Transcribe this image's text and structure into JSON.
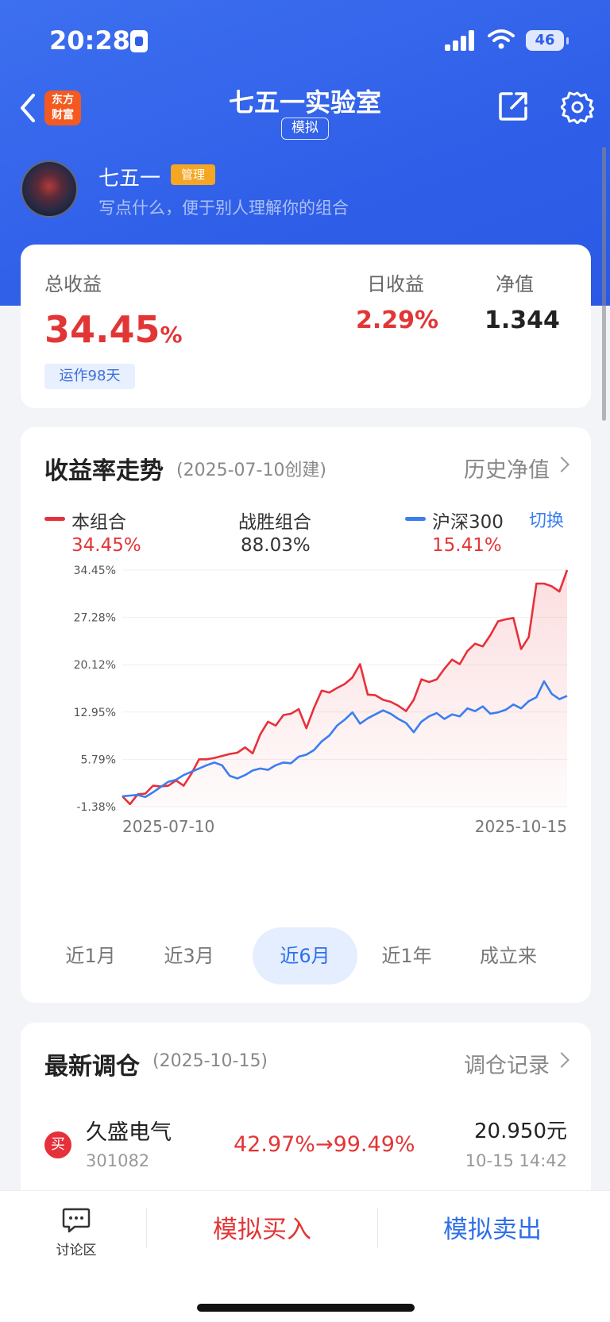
{
  "status_bar": {
    "time": "20:28",
    "battery": "46"
  },
  "header": {
    "title": "七五一实验室",
    "badge": "模拟",
    "brand_line1": "东方",
    "brand_line2": "财富"
  },
  "profile": {
    "name": "七五一",
    "role_badge": "管理",
    "description": "写点什么，便于别人理解你的组合"
  },
  "summary": {
    "total_label": "总收益",
    "total_value": "34.45",
    "total_unit": "%",
    "days": "运作98天",
    "daily_label": "日收益",
    "daily_value": "2.29%",
    "nav_label": "净值",
    "nav_value": "1.344"
  },
  "trend": {
    "title": "收益率走势",
    "created": "(2025-07-10创建)",
    "history_link": "历史净值",
    "switch": "切换",
    "legend": [
      {
        "name": "本组合",
        "value": "34.45%",
        "color": "#e8303a"
      },
      {
        "name": "战胜组合",
        "value": "88.03%",
        "color": "#333333"
      },
      {
        "name": "沪深300",
        "value": "15.41%",
        "color": "#3a7ef0"
      }
    ],
    "tabs": [
      "近1月",
      "近3月",
      "近6月",
      "近1年",
      "成立来"
    ],
    "active_tab": "近6月"
  },
  "chart_data": {
    "type": "line",
    "x_start": "2025-07-10",
    "x_end": "2025-10-15",
    "y_ticks": [
      "34.45%",
      "27.28%",
      "20.12%",
      "12.95%",
      "5.79%",
      "-1.38%"
    ],
    "ylim": [
      -1.38,
      34.45
    ],
    "grid": true,
    "series": [
      {
        "name": "本组合",
        "color": "#e8303a",
        "fill": true,
        "values": [
          0.2,
          -1.0,
          0.5,
          0.6,
          1.8,
          1.7,
          1.8,
          2.6,
          1.8,
          3.6,
          5.8,
          5.8,
          6.0,
          6.3,
          6.6,
          6.8,
          7.6,
          6.7,
          9.6,
          11.5,
          10.9,
          12.5,
          12.7,
          13.4,
          10.5,
          13.6,
          16.2,
          15.9,
          16.6,
          17.2,
          18.2,
          20.2,
          15.6,
          15.5,
          14.8,
          14.5,
          13.9,
          13.1,
          14.8,
          17.9,
          17.5,
          17.9,
          19.5,
          20.9,
          20.2,
          22.2,
          23.3,
          22.9,
          24.6,
          26.7,
          27.0,
          27.2,
          22.5,
          24.3,
          32.4,
          32.4,
          32.0,
          31.2,
          34.45
        ]
      },
      {
        "name": "沪深300",
        "color": "#3a7ef0",
        "fill": false,
        "values": [
          0.2,
          0.3,
          0.4,
          0.1,
          0.8,
          1.6,
          2.4,
          2.7,
          3.4,
          3.9,
          4.4,
          4.9,
          5.3,
          4.9,
          3.3,
          2.9,
          3.4,
          4.1,
          4.4,
          4.2,
          4.9,
          5.3,
          5.2,
          6.2,
          6.5,
          7.2,
          8.5,
          9.4,
          10.9,
          11.8,
          12.9,
          11.2,
          12.0,
          12.6,
          13.2,
          12.7,
          11.9,
          11.3,
          9.9,
          11.5,
          12.3,
          12.8,
          11.9,
          12.6,
          12.3,
          13.5,
          13.1,
          13.8,
          12.7,
          12.9,
          13.3,
          14.1,
          13.5,
          14.6,
          15.2,
          17.6,
          15.7,
          14.9,
          15.41
        ]
      }
    ]
  },
  "rebalance": {
    "title": "最新调仓",
    "date": "(2025-10-15)",
    "record_link": "调仓记录",
    "item": {
      "action": "买",
      "name": "久盛电气",
      "code": "301082",
      "change": "42.97%→99.49%",
      "price": "20.950元",
      "time": "10-15 14:42"
    }
  },
  "bottom_bar": {
    "discuss": "讨论区",
    "buy": "模拟买入",
    "sell": "模拟卖出"
  }
}
